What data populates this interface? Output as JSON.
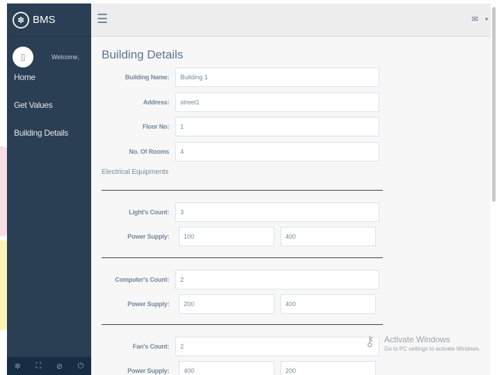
{
  "brand": {
    "name": "BMS"
  },
  "profile": {
    "welcome": "Welcome,"
  },
  "sidebar": {
    "items": [
      {
        "label": "Home"
      },
      {
        "label": "Get Values"
      },
      {
        "label": "Building Details"
      }
    ]
  },
  "page": {
    "title": "Building Details"
  },
  "building": {
    "name_label": "Building Name:",
    "name_value": "Building 1",
    "address_label": "Address:",
    "address_value": "street1",
    "floor_label": "Floor No:",
    "floor_value": "1",
    "rooms_label": "No. Of Rooms",
    "rooms_value": "4"
  },
  "electrical": {
    "section_label": "Electrical Equipments",
    "lights": {
      "count_label": "Light's Count:",
      "count_value": "3",
      "power_label": "Power Supply:",
      "power_1": "100",
      "power_2": "400"
    },
    "computers": {
      "count_label": "Computer's Count:",
      "count_value": "2",
      "power_label": "Power Supply:",
      "power_1": "200",
      "power_2": "400"
    },
    "fans": {
      "count_label": "Fan's Count:",
      "count_value": "2",
      "power_label": "Power Supply:",
      "power_1": "400",
      "power_2": "200"
    }
  },
  "watermark": {
    "title": "Activate Windows",
    "subtitle": "Go to PC settings to activate Windows."
  }
}
